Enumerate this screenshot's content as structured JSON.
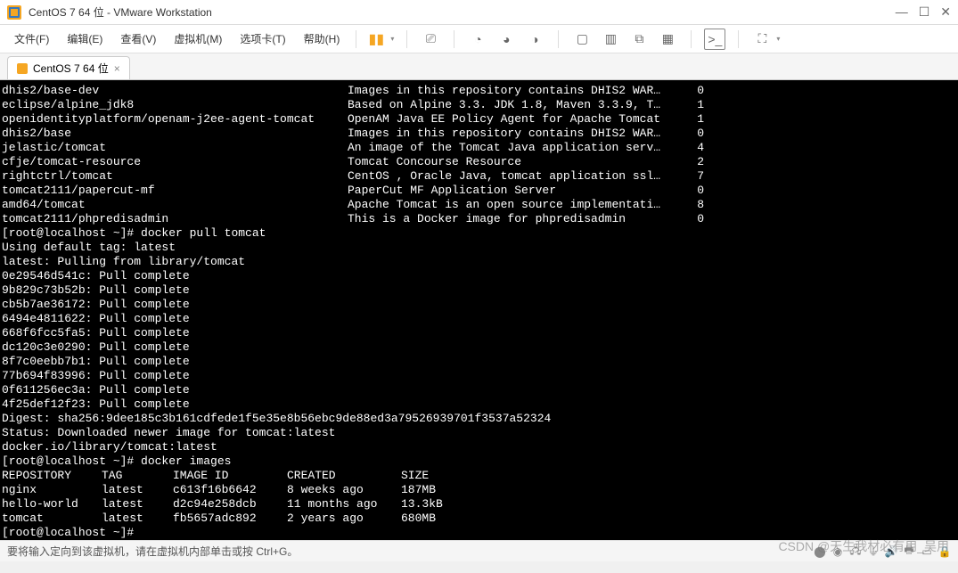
{
  "window": {
    "title": "CentOS 7 64 位 - VMware Workstation"
  },
  "menu": {
    "file": "文件(F)",
    "edit": "编辑(E)",
    "view": "查看(V)",
    "vm": "虚拟机(M)",
    "tabs": "选项卡(T)",
    "help": "帮助(H)"
  },
  "tab": {
    "label": "CentOS 7 64 位"
  },
  "search_results": [
    {
      "name": "dhis2/base-dev",
      "desc": "Images in this repository contains DHIS2 WAR…",
      "stars": "0"
    },
    {
      "name": "eclipse/alpine_jdk8",
      "desc": "Based on Alpine 3.3. JDK 1.8, Maven 3.3.9, T…",
      "stars": "1"
    },
    {
      "name": "openidentityplatform/openam-j2ee-agent-tomcat",
      "desc": "OpenAM Java EE Policy Agent for Apache Tomcat",
      "stars": "1"
    },
    {
      "name": "dhis2/base",
      "desc": "Images in this repository contains DHIS2 WAR…",
      "stars": "0"
    },
    {
      "name": "jelastic/tomcat",
      "desc": "An image of the Tomcat Java application serv…",
      "stars": "4"
    },
    {
      "name": "cfje/tomcat-resource",
      "desc": "Tomcat Concourse Resource",
      "stars": "2"
    },
    {
      "name": "rightctrl/tomcat",
      "desc": "CentOS , Oracle Java, tomcat application ssl…",
      "stars": "7"
    },
    {
      "name": "tomcat2111/papercut-mf",
      "desc": "PaperCut MF Application Server",
      "stars": "0"
    },
    {
      "name": "amd64/tomcat",
      "desc": "Apache Tomcat is an open source implementati…",
      "stars": "8"
    },
    {
      "name": "tomcat2111/phpredisadmin",
      "desc": "This is a Docker image for phpredisadmin",
      "stars": "0"
    }
  ],
  "pull": {
    "prompt1": "[root@localhost ~]# ",
    "cmd1": "docker pull tomcat",
    "tag_line": "Using default tag: latest",
    "pulling_line": "latest: Pulling from library/tomcat",
    "layers": [
      "0e29546d541c: Pull complete",
      "9b829c73b52b: Pull complete",
      "cb5b7ae36172: Pull complete",
      "6494e4811622: Pull complete",
      "668f6fcc5fa5: Pull complete",
      "dc120c3e0290: Pull complete",
      "8f7c0eebb7b1: Pull complete",
      "77b694f83996: Pull complete",
      "0f611256ec3a: Pull complete",
      "4f25def12f23: Pull complete"
    ],
    "digest": "Digest: sha256:9dee185c3b161cdfede1f5e35e8b56ebc9de88ed3a79526939701f3537a52324",
    "status": "Status: Downloaded newer image for tomcat:latest",
    "ref": "docker.io/library/tomcat:latest"
  },
  "images": {
    "prompt2": "[root@localhost ~]# ",
    "cmd2": "docker images",
    "header": {
      "repo": "REPOSITORY",
      "tag": "TAG",
      "id": "IMAGE ID",
      "created": "CREATED",
      "size": "SIZE"
    },
    "rows": [
      {
        "repo": "nginx",
        "tag": "latest",
        "id": "c613f16b6642",
        "created": "8 weeks ago",
        "size": "187MB"
      },
      {
        "repo": "hello-world",
        "tag": "latest",
        "id": "d2c94e258dcb",
        "created": "11 months ago",
        "size": "13.3kB"
      },
      {
        "repo": "tomcat",
        "tag": "latest",
        "id": "fb5657adc892",
        "created": "2 years ago",
        "size": "680MB"
      }
    ],
    "prompt3": "[root@localhost ~]# "
  },
  "status": {
    "text": "要将输入定向到该虚拟机，请在虚拟机内部单击或按 Ctrl+G。"
  },
  "watermark": "CSDN @天生我材必有用_吴用"
}
